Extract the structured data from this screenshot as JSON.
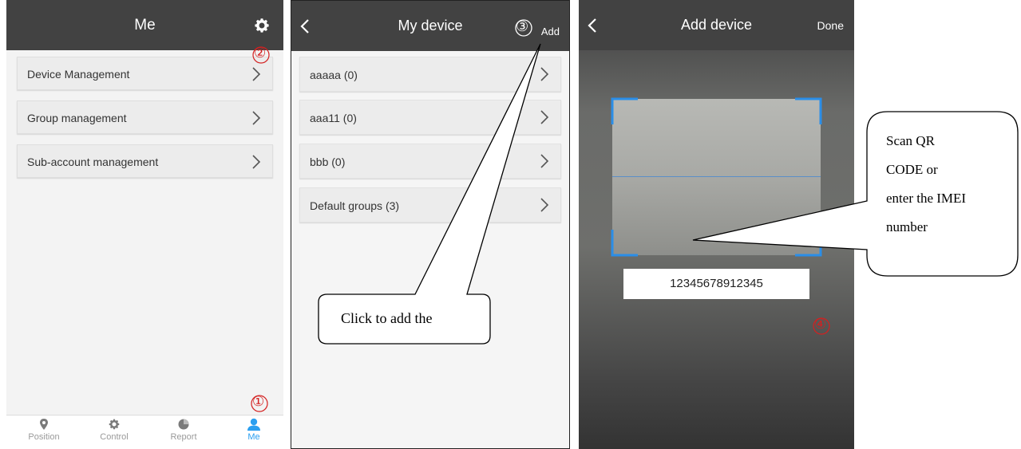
{
  "screen1": {
    "title": "Me",
    "settings_icon": "gear-icon",
    "menu": [
      {
        "label": "Device Management"
      },
      {
        "label": "Group management"
      },
      {
        "label": "Sub-account management"
      }
    ],
    "tabs": [
      {
        "label": "Position",
        "icon": "location-pin-icon"
      },
      {
        "label": "Control",
        "icon": "gear-icon"
      },
      {
        "label": "Report",
        "icon": "pie-chart-icon"
      },
      {
        "label": "Me",
        "icon": "person-icon",
        "active": true
      }
    ],
    "marker_1": "①",
    "marker_2": "②"
  },
  "screen2": {
    "title": "My device",
    "add_label": "Add",
    "marker_3": "③",
    "groups": [
      {
        "label": "aaaaa (0)"
      },
      {
        "label": "aaa11 (0)"
      },
      {
        "label": "bbb (0)"
      },
      {
        "label": "Default groups (3)"
      }
    ],
    "callout": "Click to add the"
  },
  "screen3": {
    "title": "Add device",
    "done_label": "Done",
    "imei_value": "12345678912345",
    "marker_4": "④",
    "callout_lines": [
      "Scan QR",
      "CODE or",
      "enter the IMEI",
      "number"
    ]
  },
  "colors": {
    "header_bg": "#424242",
    "accent_blue": "#2a9ff0",
    "marker_red": "#d42020"
  }
}
